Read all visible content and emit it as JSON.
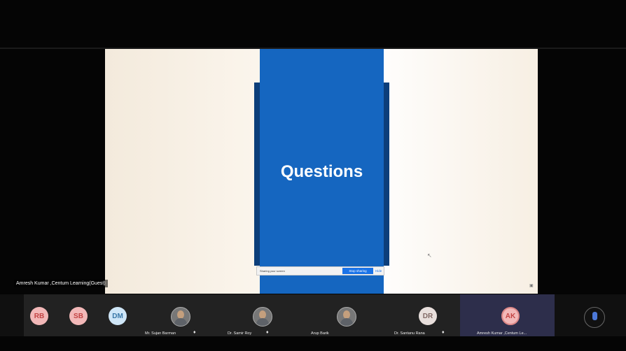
{
  "slide": {
    "title": "Questions"
  },
  "sharing_bar": {
    "message": "Sharing your screen",
    "stop_button": "Stop sharing",
    "hide_button": "Hide"
  },
  "presenter": {
    "name": "Amresh Kumar ,Centum Learning(Guest)"
  },
  "participants": [
    {
      "initials": "RB",
      "name": ""
    },
    {
      "initials": "SB",
      "name": ""
    },
    {
      "initials": "DM",
      "name": ""
    },
    {
      "initials": "",
      "name": "Mr. Sujan Barman"
    },
    {
      "initials": "",
      "name": "Dr. Samir Roy"
    },
    {
      "initials": "",
      "name": "Arup Barik"
    },
    {
      "initials": "DR",
      "name": "Dr. Santanu Rana"
    },
    {
      "initials": "AK",
      "name": "Amresh Kumar ,Centum Le..."
    }
  ],
  "icons": {
    "mic": "microphone-icon",
    "cursor": "mouse-cursor-icon"
  },
  "colors": {
    "slide_band": "#1566C0",
    "slide_band_shadow": "#0C3E7A",
    "background": "#050505",
    "share_button": "#1A73E8"
  }
}
